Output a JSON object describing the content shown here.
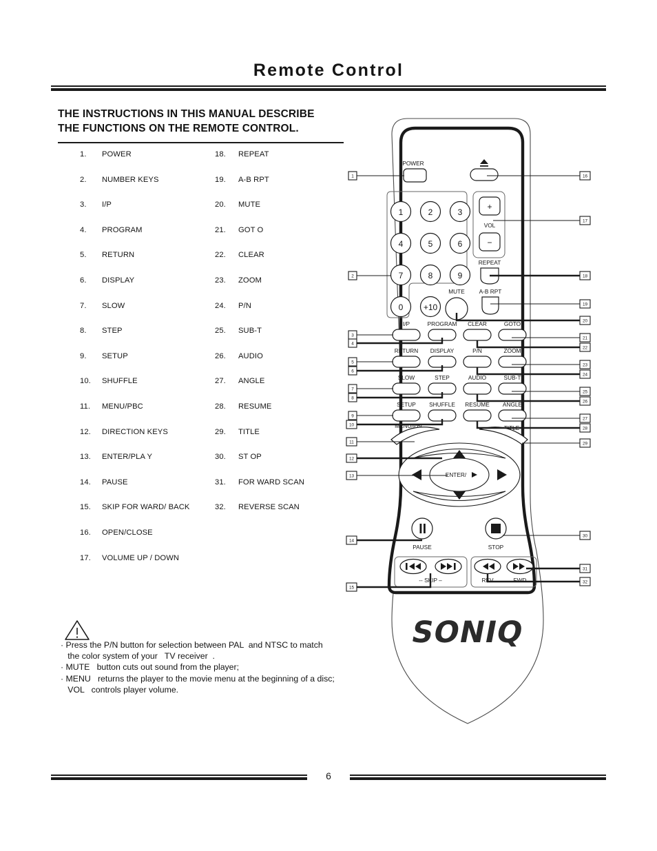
{
  "page": {
    "title": "Remote Control",
    "footer_page_number": "6"
  },
  "intro": {
    "line1": "THE INSTRUCTIONS IN THIS MANUAL DESCRIBE",
    "line2": "THE FUNCTIONS ON  THE REMOTE CONTROL."
  },
  "function_list": {
    "left_column": [
      {
        "num": "1.",
        "label": "POWER"
      },
      {
        "num": "2.",
        "label": "NUMBER KEYS"
      },
      {
        "num": "3.",
        "label": "I/P"
      },
      {
        "num": "4.",
        "label": "PROGRAM"
      },
      {
        "num": "5.",
        "label": "RETURN"
      },
      {
        "num": "6.",
        "label": "DISPLAY"
      },
      {
        "num": "7.",
        "label": "SLOW"
      },
      {
        "num": "8.",
        "label": "STEP"
      },
      {
        "num": "9.",
        "label": "SETUP"
      },
      {
        "num": "10.",
        "label": "SHUFFLE"
      },
      {
        "num": "11.",
        "label": "MENU/PBC"
      },
      {
        "num": "12.",
        "label": "DIRECTION KEYS"
      },
      {
        "num": "13.",
        "label": "ENTER/PLA Y"
      },
      {
        "num": "14.",
        "label": "PAUSE"
      },
      {
        "num": "15.",
        "label": "SKIP  FOR WARD/ BACK"
      },
      {
        "num": "16.",
        "label": "OPEN/CLOSE"
      },
      {
        "num": "17.",
        "label": "VOLUME  UP / DOWN"
      }
    ],
    "right_column": [
      {
        "num": "18.",
        "label": "REPEAT"
      },
      {
        "num": "19.",
        "label": "A-B RPT"
      },
      {
        "num": "20.",
        "label": "MUTE"
      },
      {
        "num": "21.",
        "label": "GOT O"
      },
      {
        "num": "22.",
        "label": "CLEAR"
      },
      {
        "num": "23.",
        "label": "ZOOM"
      },
      {
        "num": "24.",
        "label": "P/N"
      },
      {
        "num": "25.",
        "label": "SUB-T"
      },
      {
        "num": "26.",
        "label": "AUDIO"
      },
      {
        "num": "27.",
        "label": "ANGLE"
      },
      {
        "num": "28.",
        "label": "RESUME"
      },
      {
        "num": "29.",
        "label": "TITLE"
      },
      {
        "num": "30.",
        "label": "ST OP"
      },
      {
        "num": "31.",
        "label": "FOR WARD SCAN"
      },
      {
        "num": "32.",
        "label": "REVERSE SCAN"
      }
    ]
  },
  "notes": {
    "line1": "· Press the P/N button for selection between PAL  and NTSC to match",
    "line2": "   the color system of your   TV receiver  .",
    "line3": "· MUTE   button cuts out sound from the player;",
    "line4": "· MENU   returns the player to the movie menu at the beginning of a disc;",
    "line5": "   VOL   controls player volume."
  },
  "remote": {
    "brand": "SONIQ",
    "buttons": {
      "power": "POWER",
      "open_close_icon": "eject-icon",
      "vol": "VOL",
      "vol_up": "+",
      "vol_down": "−",
      "repeat": "REPEAT",
      "ab_rpt": "A-B RPT",
      "mute": "MUTE",
      "clear": "CLEAR",
      "goto": "GOTO",
      "ip": "I/P",
      "program": "PROGRAM",
      "return": "RETURN",
      "display": "DISPLAY",
      "pn": "P/N",
      "zoom": "ZOOM",
      "slow": "SLOW",
      "step": "STEP",
      "audio": "AUDIO",
      "sub_t": "SUB-T",
      "setup": "SETUP",
      "shuffle": "SHUFFLE",
      "resume": "RESUME",
      "angle": "ANGLE",
      "menu_pbc": "MENU/PBC",
      "title": "TITLE",
      "enter_play": "ENTER/",
      "pause": "PAUSE",
      "stop": "STOP",
      "skip": "-- SKIP –",
      "rev": "REV",
      "fwd": "FWD"
    },
    "number_keys": [
      "1",
      "2",
      "3",
      "4",
      "5",
      "6",
      "7",
      "8",
      "9",
      "0",
      "+10"
    ],
    "callouts_left": [
      "1",
      "2",
      "3",
      "4",
      "5",
      "6",
      "7",
      "8",
      "9",
      "10",
      "11",
      "12",
      "13",
      "14",
      "15"
    ],
    "callouts_right": [
      "16",
      "17",
      "18",
      "19",
      "20",
      "21",
      "22",
      "23",
      "24",
      "25",
      "26",
      "27",
      "28",
      "29",
      "30",
      "31",
      "32"
    ]
  },
  "colors": {
    "ink": "#1a1a1a",
    "paper": "#ffffff"
  }
}
